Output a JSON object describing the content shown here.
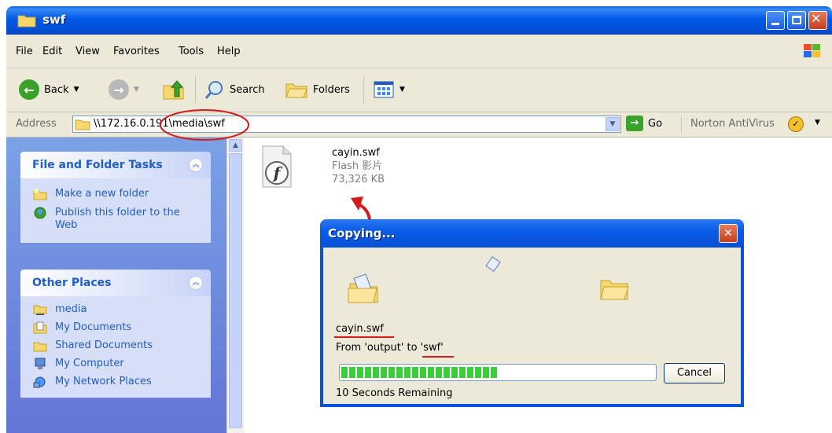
{
  "window": {
    "title": "swf"
  },
  "menu": [
    "File",
    "Edit",
    "View",
    "Favorites",
    "Tools",
    "Help"
  ],
  "toolbar": {
    "back": "Back",
    "search": "Search",
    "folders": "Folders"
  },
  "address": {
    "label": "Address",
    "value": "\\\\172.16.0.191\\media\\swf",
    "go": "Go",
    "norton": "Norton AntiVirus"
  },
  "tasks": {
    "title": "File and Folder Tasks",
    "items": [
      "Make a new folder",
      "Publish this folder to the Web"
    ]
  },
  "places": {
    "title": "Other Places",
    "items": [
      "media",
      "My Documents",
      "Shared Documents",
      "My Computer",
      "My Network Places"
    ]
  },
  "file": {
    "name": "cayin.swf",
    "type": "Flash 影片",
    "size": "73,326 KB"
  },
  "dialog": {
    "title": "Copying...",
    "filename": "cayin.swf",
    "from_to": "From 'output' to 'swf'",
    "remaining": "10 Seconds Remaining",
    "cancel": "Cancel",
    "progress": 0.49
  },
  "colors": {
    "titlebar": "#0058e6",
    "task_link": "#215dc6",
    "progress": "#3acf3a",
    "annotation": "#d41c1c"
  }
}
